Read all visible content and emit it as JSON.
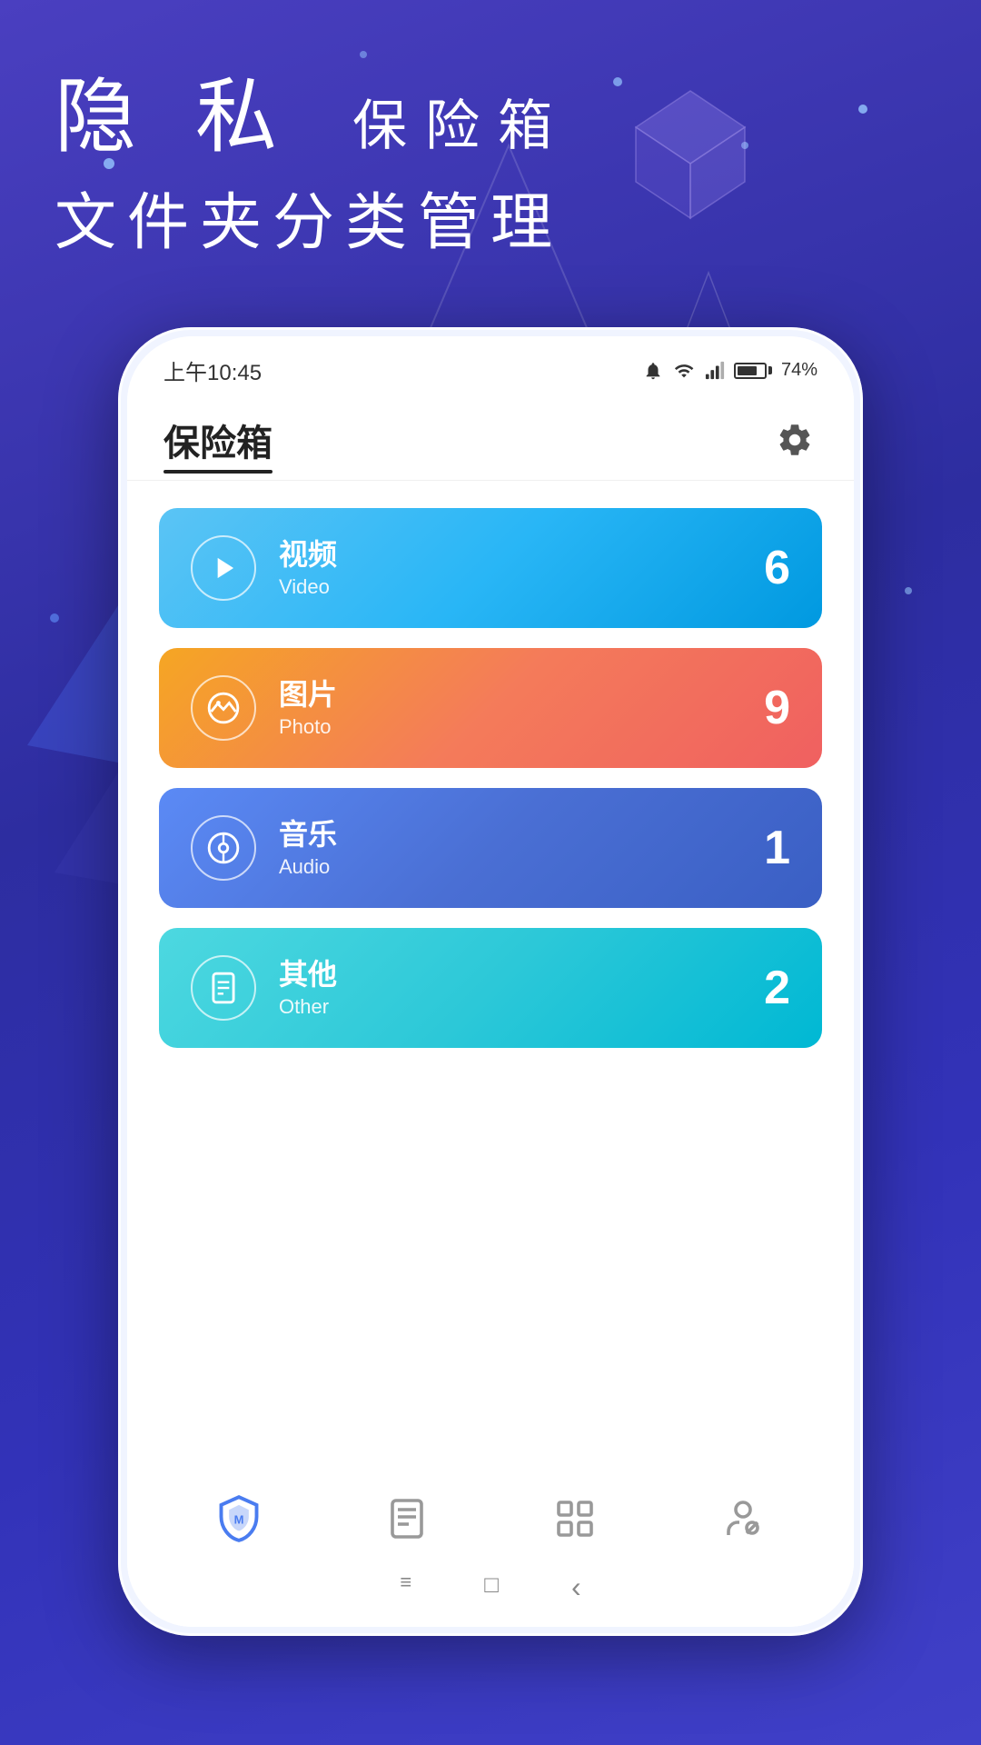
{
  "background": {
    "gradient_start": "#4a3fc0",
    "gradient_end": "#3232b8"
  },
  "header": {
    "line1_part1": "隐 私",
    "line1_part2": "保险箱",
    "line2": "文件夹分类管理"
  },
  "status_bar": {
    "time": "上午10:45",
    "battery_percent": "74%"
  },
  "app": {
    "title": "保险箱",
    "settings_icon": "gear-icon"
  },
  "categories": [
    {
      "id": "video",
      "name_cn": "视频",
      "name_en": "Video",
      "count": "6",
      "icon": "play-icon",
      "gradient": "video"
    },
    {
      "id": "photo",
      "name_cn": "图片",
      "name_en": "Photo",
      "count": "9",
      "icon": "photo-icon",
      "gradient": "photo"
    },
    {
      "id": "audio",
      "name_cn": "音乐",
      "name_en": "Audio",
      "count": "1",
      "icon": "music-icon",
      "gradient": "audio"
    },
    {
      "id": "other",
      "name_cn": "其他",
      "name_en": "Other",
      "count": "2",
      "icon": "file-icon",
      "gradient": "other"
    }
  ],
  "bottom_nav": [
    {
      "id": "shield",
      "icon": "shield-icon",
      "active": true
    },
    {
      "id": "document",
      "icon": "document-icon",
      "active": false
    },
    {
      "id": "grid",
      "icon": "grid-icon",
      "active": false
    },
    {
      "id": "person",
      "icon": "person-icon",
      "active": false
    }
  ],
  "system_nav": {
    "menu_icon": "≡",
    "home_icon": "□",
    "back_icon": "‹"
  }
}
